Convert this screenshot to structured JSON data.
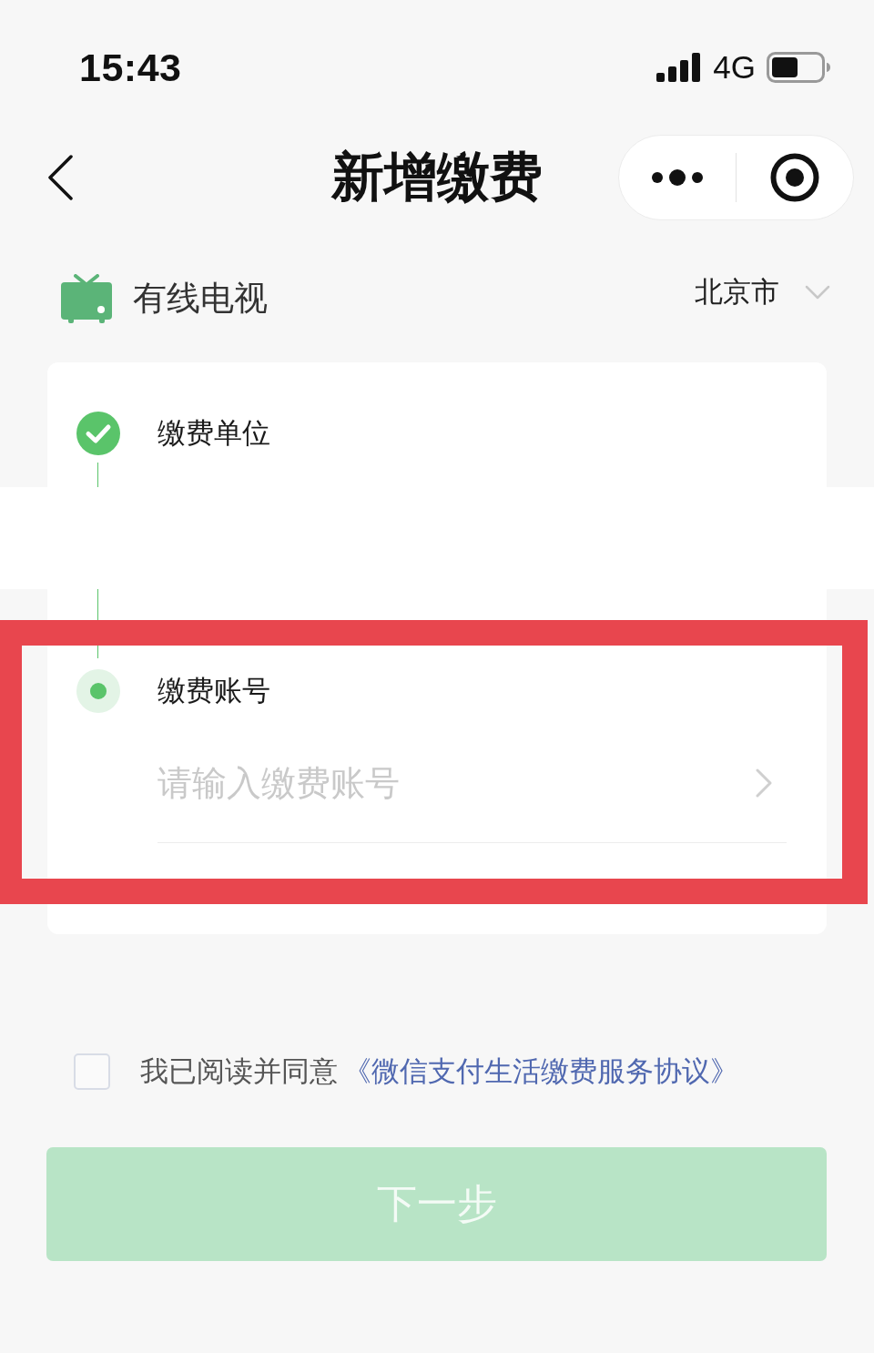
{
  "status_bar": {
    "time": "15:43",
    "network": "4G"
  },
  "nav_bar": {
    "title": "新增缴费"
  },
  "category": {
    "name": "有线电视",
    "city": "北京市"
  },
  "steps": [
    {
      "label": "缴费单位",
      "done": true
    },
    {
      "label": "缴费账号",
      "done": false,
      "input": {
        "placeholder": "请输入缴费账号"
      }
    }
  ],
  "agreement": {
    "checked": false,
    "text": "我已阅读并同意",
    "link": "《微信支付生活缴费服务协议》"
  },
  "next_button": {
    "label": "下一步",
    "disabled": true
  }
}
